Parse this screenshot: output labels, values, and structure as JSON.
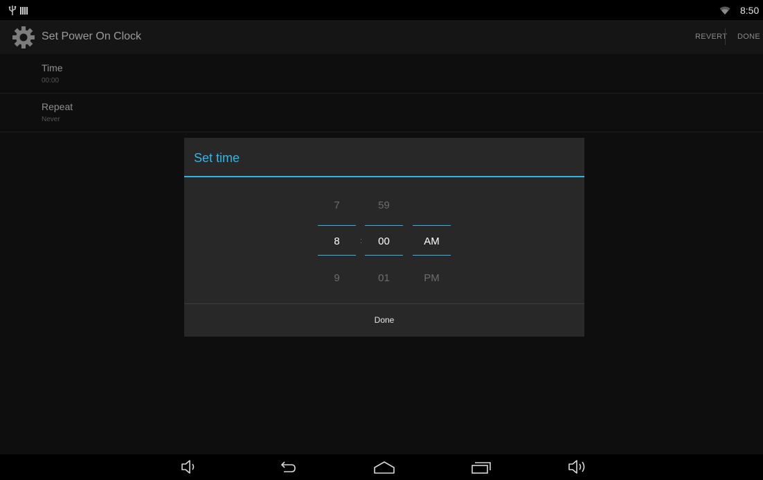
{
  "status_bar": {
    "time": "8:50",
    "icons": [
      "usb-icon",
      "sd-card-icon",
      "wifi-icon"
    ]
  },
  "action_bar": {
    "title": "Set Power On Clock",
    "revert_label": "REVERT",
    "done_label": "DONE",
    "icon": "settings-gear-icon"
  },
  "preferences": [
    {
      "title": "Time",
      "summary": "00:00"
    },
    {
      "title": "Repeat",
      "summary": "Never"
    }
  ],
  "dialog": {
    "title": "Set time",
    "separator": ":",
    "hour": {
      "prev": "7",
      "current": "8",
      "next": "9"
    },
    "minute": {
      "prev": "59",
      "current": "00",
      "next": "01"
    },
    "ampm": {
      "prev": "",
      "current": "AM",
      "next": "PM"
    },
    "done_label": "Done"
  },
  "nav_bar": {
    "icons": [
      "volume-down-icon",
      "back-icon",
      "home-icon",
      "recent-apps-icon",
      "volume-up-icon"
    ]
  },
  "colors": {
    "accent": "#33b5e5",
    "background": "#000000",
    "dialog": "#282828"
  }
}
